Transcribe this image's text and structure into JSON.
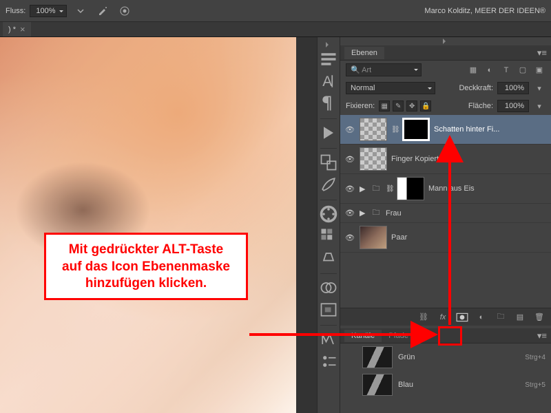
{
  "top": {
    "flow_label": "Fluss:",
    "flow_value": "100%",
    "author": "Marco Kolditz, MEER DER IDEEN®"
  },
  "doc_tab": {
    "name": ") *",
    "close": "×"
  },
  "panels": {
    "layers_title": "Ebenen",
    "search_label": "Art",
    "blend_mode": "Normal",
    "opacity_label": "Deckkraft:",
    "opacity_value": "100%",
    "lock_label": "Fixieren:",
    "fill_label": "Fläche:",
    "fill_value": "100%"
  },
  "layers": [
    {
      "name": "Schatten hinter Fi..."
    },
    {
      "name": "Finger Kopiert"
    },
    {
      "name": "Mann aus Eis"
    },
    {
      "name": "Frau"
    },
    {
      "name": "Paar"
    }
  ],
  "channels": {
    "title": "Kanäle",
    "paths_title": "Pfade",
    "rows": [
      {
        "name": "Grün",
        "shortcut": "Strg+4"
      },
      {
        "name": "Blau",
        "shortcut": "Strg+5"
      }
    ]
  },
  "annotation": {
    "line1": "Mit gedrückter ALT-Taste",
    "line2": "auf das Icon Ebenenmaske",
    "line3": "hinzufügen klicken."
  },
  "icons": {
    "airbrush": "airbrush-icon",
    "pressure": "pressure-opacity-icon"
  }
}
